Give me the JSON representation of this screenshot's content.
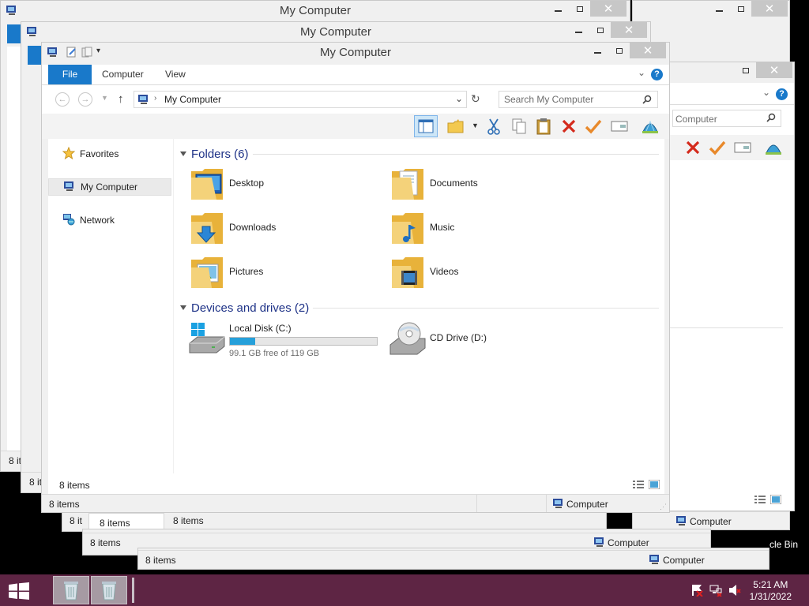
{
  "window_title": "My Computer",
  "ribbon": {
    "file": "File",
    "computer": "Computer",
    "view": "View",
    "help": "?"
  },
  "address": {
    "path": "My Computer",
    "search_placeholder": "Search My Computer"
  },
  "nav": [
    {
      "label": "Favorites",
      "icon": "star-icon"
    },
    {
      "label": "My Computer",
      "icon": "computer-icon"
    },
    {
      "label": "Network",
      "icon": "network-icon"
    }
  ],
  "groups": {
    "folders": "Folders (6)",
    "drives": "Devices and drives (2)"
  },
  "folders": [
    {
      "label": "Desktop",
      "icon": "desktop-folder-icon"
    },
    {
      "label": "Documents",
      "icon": "documents-folder-icon"
    },
    {
      "label": "Downloads",
      "icon": "downloads-folder-icon"
    },
    {
      "label": "Music",
      "icon": "music-folder-icon"
    },
    {
      "label": "Pictures",
      "icon": "pictures-folder-icon"
    },
    {
      "label": "Videos",
      "icon": "videos-folder-icon"
    }
  ],
  "drives": [
    {
      "label": "Local Disk (C:)",
      "free_text": "99.1 GB free of 119 GB",
      "used_fraction": 0.17
    },
    {
      "label": "CD Drive (D:)"
    }
  ],
  "status": {
    "inner": "8 items",
    "outer": "8 items",
    "computer": "Computer"
  },
  "background_windows": {
    "status_items": "8 items",
    "status_computer": "Computer",
    "partial_left": "8 it",
    "search_partial": "Computer",
    "recycle_partial": "cle Bin"
  },
  "taskbar": {
    "time": "5:21 AM",
    "date": "1/31/2022",
    "accent": "#5e2544"
  }
}
